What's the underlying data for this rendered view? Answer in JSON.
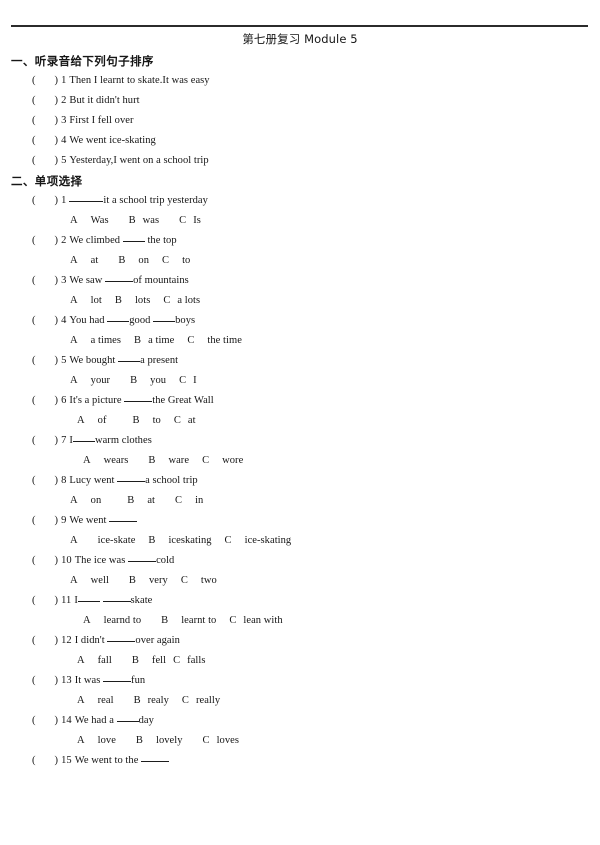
{
  "document": {
    "title": "第七册复习 Module 5",
    "top_rule_color": "#2b2b2b",
    "text_color": "#161616"
  },
  "sections": [
    {
      "heading": "一、听录音给下列句子排序",
      "type": "ordering",
      "items": [
        {
          "bracket_open": "(",
          "bracket_close": ")",
          "number": "1",
          "text": "Then I learnt to skate.It was easy"
        },
        {
          "bracket_open": "(",
          "bracket_close": ")",
          "number": "2",
          "text": "But it didn't hurt"
        },
        {
          "bracket_open": "(",
          "bracket_close": ")",
          "number": "3",
          "text": "First I fell over"
        },
        {
          "bracket_open": "(",
          "bracket_close": ")",
          "number": "4",
          "text": "We went ice-skating"
        },
        {
          "bracket_open": "(",
          "bracket_close": ")",
          "number": "5",
          "text": "Yesterday,I went on a school trip"
        }
      ]
    },
    {
      "heading": "二、单项选择",
      "type": "multiple-choice",
      "questions": [
        {
          "number": "1",
          "stem_before": "",
          "stem_after": "it a school trip yesterday",
          "options": [
            "A   Was",
            "B was",
            "C Is"
          ],
          "option_letters": [
            "A",
            "B",
            "C"
          ],
          "option_texts": [
            "Was",
            "was",
            "Is"
          ]
        },
        {
          "number": "2",
          "stem_before": "We climbed ",
          "stem_after": " the top",
          "option_letters": [
            "A",
            "B",
            "C"
          ],
          "option_texts": [
            "at",
            "on",
            "to"
          ]
        },
        {
          "number": "3",
          "stem_before": "We saw ",
          "stem_after": "of mountains",
          "option_letters": [
            "A",
            "B",
            "C"
          ],
          "option_texts": [
            "lot",
            "lots",
            "a lots"
          ]
        },
        {
          "number": "4",
          "stem_before": "You had ",
          "stem_mid": "good ",
          "stem_after": "boys",
          "option_letters": [
            "A",
            "B",
            "C"
          ],
          "option_texts": [
            "a   times",
            "a   time",
            "the   time"
          ]
        },
        {
          "number": "5",
          "stem_before": "We bought ",
          "stem_after": "a present",
          "option_letters": [
            "A",
            "B",
            "C"
          ],
          "option_texts": [
            "your",
            "you",
            "I"
          ]
        },
        {
          "number": "6",
          "stem_before": "It's a picture ",
          "stem_after": "the Great Wall",
          "option_letters": [
            "A",
            "B",
            "C"
          ],
          "option_texts": [
            "of",
            "to",
            "at"
          ]
        },
        {
          "number": "7",
          "stem_before": "I",
          "stem_after": "warm clothes",
          "option_letters": [
            "A",
            "B",
            "C"
          ],
          "option_texts": [
            "wears",
            "ware",
            "wore"
          ]
        },
        {
          "number": "8",
          "stem_before": "Lucy went ",
          "stem_after": "a school trip",
          "option_letters": [
            "A",
            "B",
            "C"
          ],
          "option_texts": [
            "on",
            "at",
            "in"
          ]
        },
        {
          "number": "9",
          "stem_before": "We went ",
          "stem_after": "",
          "option_letters": [
            "A",
            "B",
            "C"
          ],
          "option_texts": [
            "ice-skate",
            "iceskating",
            "ice-skating"
          ]
        },
        {
          "number": "10",
          "stem_before": "The ice was ",
          "stem_after": "cold",
          "option_letters": [
            "A",
            "B",
            "C"
          ],
          "option_texts": [
            "well",
            "very",
            "two"
          ]
        },
        {
          "number": "11",
          "stem_before": "I",
          "stem_mid": " ",
          "stem_after": "skate",
          "option_letters": [
            "A",
            "B",
            "C"
          ],
          "option_texts": [
            "learnd   to",
            "learnt   to",
            "lean   with"
          ]
        },
        {
          "number": "12",
          "stem_before": "I didn't ",
          "stem_after": "over again",
          "option_letters": [
            "A",
            "B",
            "C"
          ],
          "option_texts": [
            "fall",
            "fell",
            "falls"
          ]
        },
        {
          "number": "13",
          "stem_before": "It was ",
          "stem_after": "fun",
          "option_letters": [
            "A",
            "B",
            "C"
          ],
          "option_texts": [
            "real",
            "realy",
            "really"
          ]
        },
        {
          "number": "14",
          "stem_before": "We had a ",
          "stem_after": "day",
          "option_letters": [
            "A",
            "B",
            "C"
          ],
          "option_texts": [
            "love",
            "lovely",
            "loves"
          ]
        },
        {
          "number": "15",
          "stem_before": "We went to the ",
          "stem_after": "",
          "option_letters": [],
          "option_texts": []
        }
      ]
    }
  ]
}
